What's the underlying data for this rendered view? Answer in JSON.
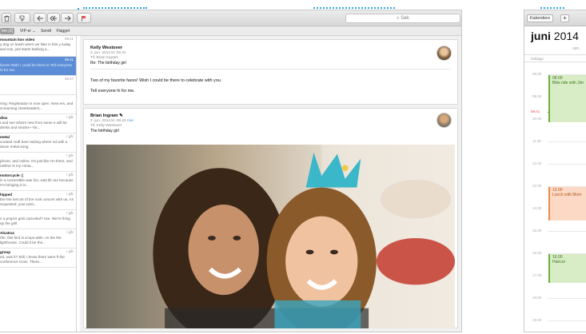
{
  "mail": {
    "search_placeholder": "Søk",
    "favorites": [
      "Inn (2)",
      "VIP-er ⌄",
      "Sendt",
      "Flagget"
    ],
    "messages": [
      {
        "subject": "mountain lion video",
        "preview": "y dog on leash when we hike in this y today and mix, just starts barking a...",
        "time": "09.41",
        "selected": false
      },
      {
        "subject": "",
        "preview": "faces! Wish I could be there to Tell everyone hi for me.",
        "time": "09.41",
        "selected": true
      },
      {
        "subject": "",
        "preview": "",
        "time": "08.47",
        "selected": false
      },
      {
        "subject": "",
        "preview": "ning: Registration is now open. New ers, and screaming cheerleaders...",
        "time": "",
        "selected": false
      },
      {
        "subject": "dios",
        "preview": "t and see what's new from some e will be drinks and snacks—for...",
        "time": "I går",
        "selected": false
      },
      {
        "subject": "metal",
        "preview": "curated craft beer tasting where nd with a doom metal song.",
        "time": "I går",
        "selected": false
      },
      {
        "subject": "",
        "preview": "phone, and online. It's just like I'm there, and neither is my conta...",
        "time": "I går",
        "selected": false
      },
      {
        "subject": "motorcycle :(",
        "preview": "in a convertible was fun, wait till can because I'm bringing it in...",
        "time": "I går",
        "selected": false
      },
      {
        "subject": "hipped",
        "preview": "live the lost art of the rock concert with us. As requested, your post...",
        "time": "I går",
        "selected": false
      },
      {
        "subject": "",
        "preview": "n a project gets canceled? ose. We're firing up the grill.",
        "time": "I går",
        "selected": false
      },
      {
        "subject": "Alcatraz",
        "preview": "rfer, this bird is scope-able, on the the lighthouse. Could it be the...",
        "time": "I går",
        "selected": false
      },
      {
        "subject": "group",
        "preview": "ed, was it? Still, I know there were ft the conference room. There...",
        "time": "I går",
        "selected": false
      }
    ],
    "reader": {
      "first": {
        "sender": "Kelly Westover",
        "date": "2. jun. 2014 kl. 09.41",
        "to": "Til: Brian Ingram",
        "subject": "Re: The birthday girl",
        "body1": "Two of my favorite faces! Wish I could be there to celebrate with you.",
        "body2": "Tell everyone hi for me."
      },
      "second": {
        "sender": "Brian Ingram",
        "date": "2. jun. 2014 kl. 08.43",
        "more": "mer",
        "to": "Til: Kelly Westover",
        "subject": "The birthday girl"
      }
    }
  },
  "calendar": {
    "tab_label": "Kalendere",
    "add_label": "+",
    "month": "juni",
    "year": "2014",
    "day_label": "søn.",
    "allday_label": "heldags",
    "now_time": "09.41",
    "hours": [
      "08.00",
      "09.00",
      "10.00",
      "11.00",
      "12.00",
      "13.00",
      "14.00",
      "15.00",
      "16.00",
      "17.00",
      "18.00",
      "19.00"
    ],
    "events": [
      {
        "time": "08.00",
        "title": "Bike ride with Jim",
        "color": "green"
      },
      {
        "time": "13.00",
        "title": "Lunch with Mom",
        "color": "orange"
      },
      {
        "time": "16.00",
        "title": "Haircut",
        "color": "green"
      }
    ]
  },
  "colors": {
    "accent": "#29a8e0",
    "selection": "#5b8ed6",
    "now": "#e54b4b",
    "event_green": "#d8ecc6",
    "event_orange": "#fbd9c4"
  }
}
